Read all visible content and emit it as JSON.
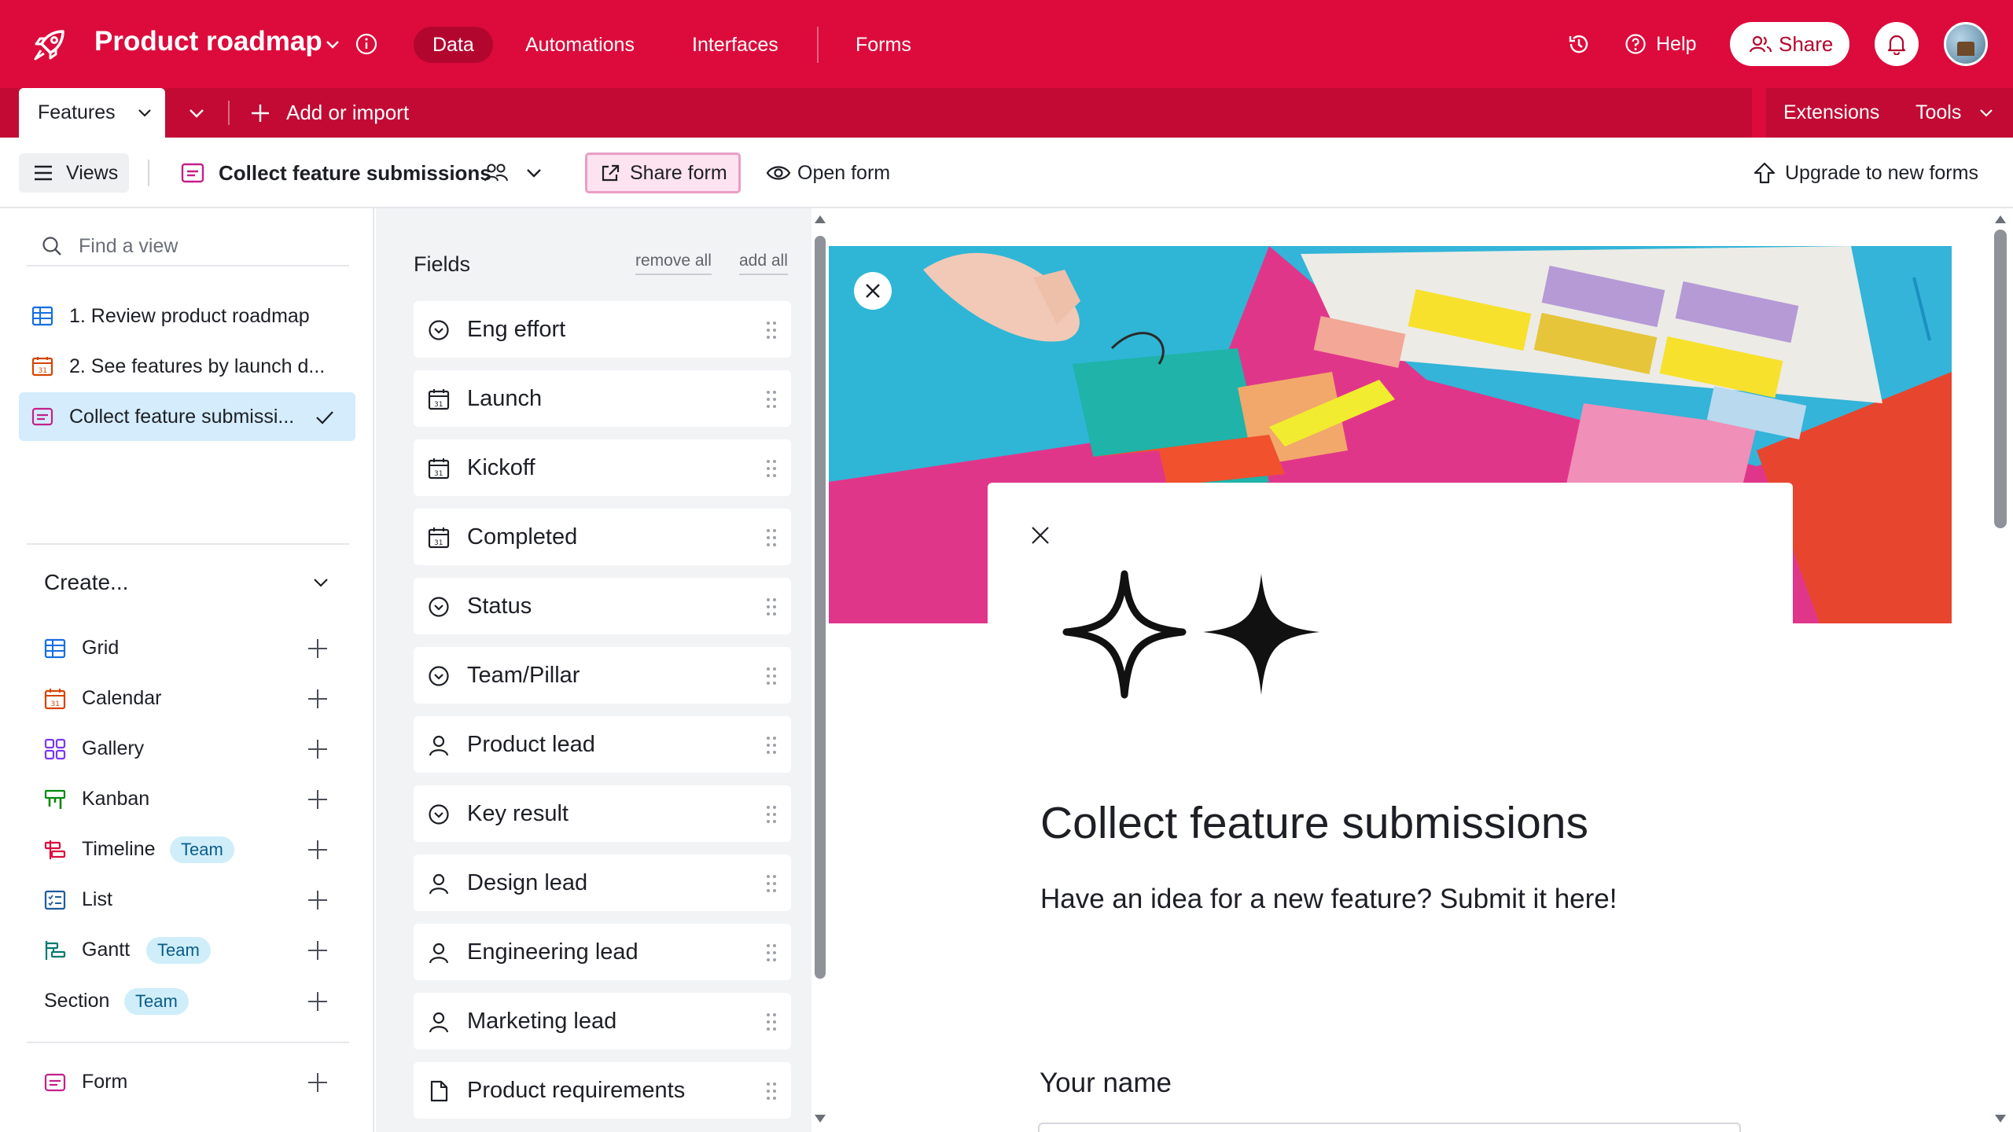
{
  "app": {
    "title": "Product roadmap",
    "nav_tabs": [
      {
        "label": "Data",
        "active": true
      },
      {
        "label": "Automations",
        "active": false
      },
      {
        "label": "Interfaces",
        "active": false
      },
      {
        "label": "Forms",
        "active": false
      }
    ],
    "help_label": "Help",
    "share_label": "Share",
    "brand_color": "#dc0b3c"
  },
  "tables": {
    "active_tab": "Features",
    "add_import_label": "Add or import",
    "extensions_label": "Extensions",
    "tools_label": "Tools"
  },
  "viewbar": {
    "views_label": "Views",
    "current_view": "Collect feature submissions",
    "share_form_label": "Share form",
    "open_form_label": "Open form",
    "upgrade_label": "Upgrade to new forms"
  },
  "sidebar": {
    "search_placeholder": "Find a view",
    "views": [
      {
        "label": "1. Review product roadmap",
        "icon": "grid-icon",
        "active": false
      },
      {
        "label": "2. See features by launch d...",
        "icon": "calendar-icon",
        "active": false
      },
      {
        "label": "Collect feature submissi...",
        "icon": "form-icon",
        "active": true
      }
    ],
    "create_label": "Create...",
    "create_items": [
      {
        "label": "Grid",
        "icon": "grid-icon",
        "badge": ""
      },
      {
        "label": "Calendar",
        "icon": "calendar-icon",
        "badge": ""
      },
      {
        "label": "Gallery",
        "icon": "gallery-icon",
        "badge": ""
      },
      {
        "label": "Kanban",
        "icon": "kanban-icon",
        "badge": ""
      },
      {
        "label": "Timeline",
        "icon": "timeline-icon",
        "badge": "Team"
      },
      {
        "label": "List",
        "icon": "list-icon",
        "badge": ""
      },
      {
        "label": "Gantt",
        "icon": "gantt-icon",
        "badge": "Team"
      },
      {
        "label": "Section",
        "icon": "",
        "badge": "Team"
      },
      {
        "label": "Form",
        "icon": "form-icon",
        "badge": ""
      }
    ]
  },
  "fields_panel": {
    "title": "Fields",
    "remove_all_label": "remove all",
    "add_all_label": "add all",
    "fields": [
      {
        "label": "Eng effort",
        "icon": "single-select-icon"
      },
      {
        "label": "Launch",
        "icon": "date-icon"
      },
      {
        "label": "Kickoff",
        "icon": "date-icon"
      },
      {
        "label": "Completed",
        "icon": "date-icon"
      },
      {
        "label": "Status",
        "icon": "single-select-icon"
      },
      {
        "label": "Team/Pillar",
        "icon": "single-select-icon"
      },
      {
        "label": "Product lead",
        "icon": "user-icon"
      },
      {
        "label": "Key result",
        "icon": "single-select-icon"
      },
      {
        "label": "Design lead",
        "icon": "user-icon"
      },
      {
        "label": "Engineering lead",
        "icon": "user-icon"
      },
      {
        "label": "Marketing lead",
        "icon": "user-icon"
      },
      {
        "label": "Product requirements",
        "icon": "document-icon"
      }
    ]
  },
  "form_preview": {
    "title": "Collect feature submissions",
    "description": "Have an idea for a new feature? Submit it here!",
    "first_field_label": "Your name",
    "logo_icon": "sparkles-icon"
  }
}
